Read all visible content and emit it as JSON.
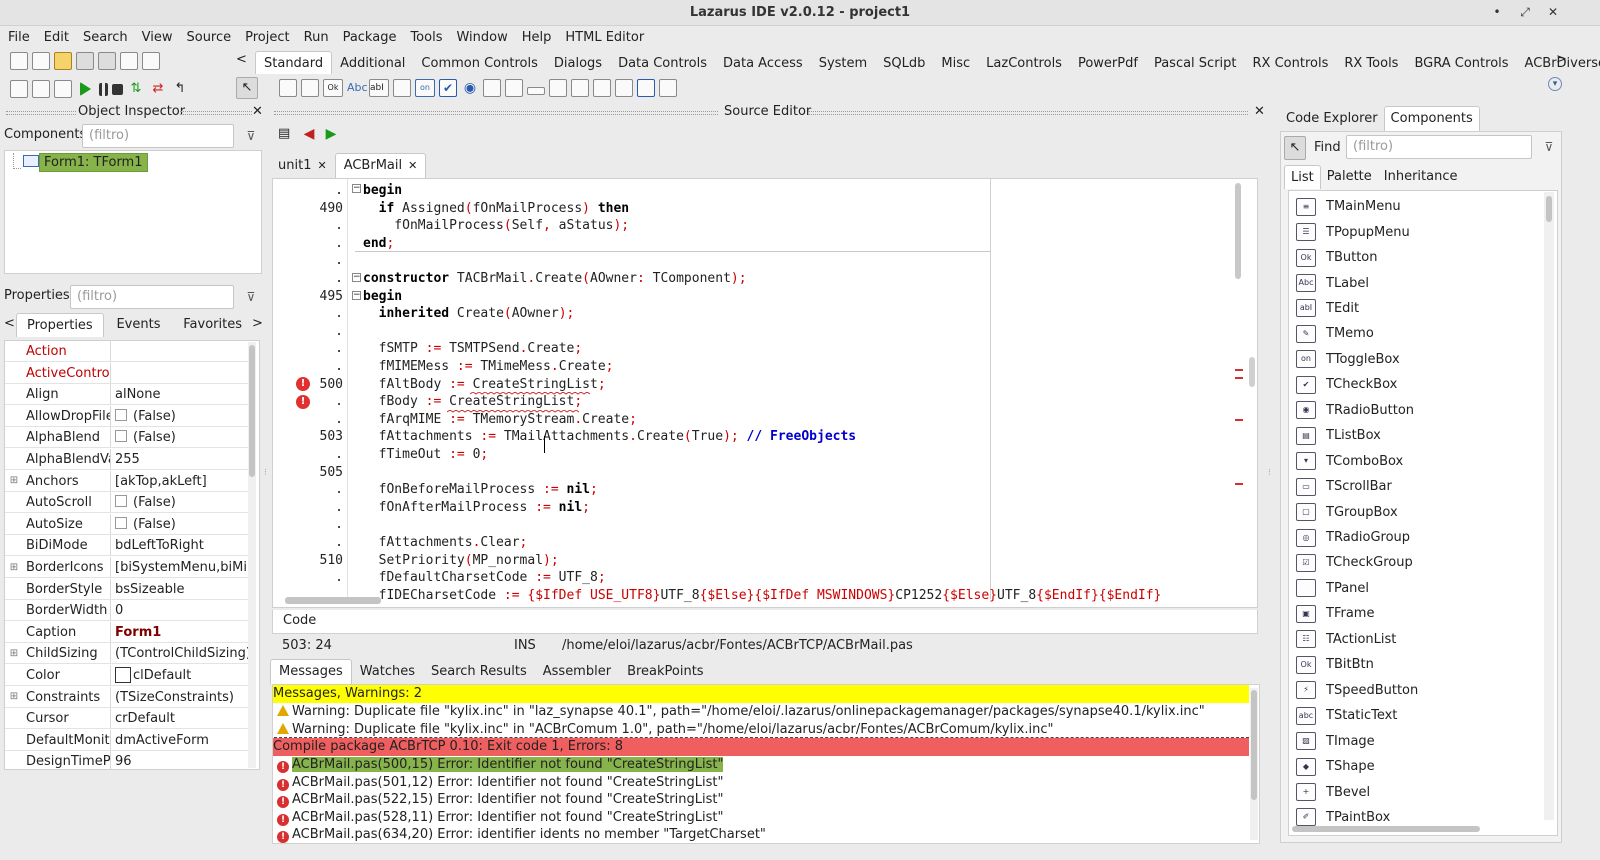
{
  "window": {
    "title": "Lazarus IDE v2.0.12 - project1",
    "minimize": "•",
    "restore": "⤢",
    "close": "✕"
  },
  "menu": [
    "File",
    "Edit",
    "Search",
    "View",
    "Source",
    "Project",
    "Run",
    "Package",
    "Tools",
    "Window",
    "Help",
    "HTML Editor"
  ],
  "palette_tabs": [
    "Standard",
    "Additional",
    "Common Controls",
    "Dialogs",
    "Data Controls",
    "Data Access",
    "System",
    "SQLdb",
    "Misc",
    "LazControls",
    "PowerPdf",
    "Pascal Script",
    "RX Controls",
    "RX Tools",
    "BGRA Controls",
    "ACBrDiversos"
  ],
  "palette_selected": "Standard",
  "palette_scroll_left": "<",
  "palette_scroll_right": ">",
  "object_inspector": {
    "title": "Object Inspector",
    "components_label": "Components",
    "filter_placeholder": "(filtro)",
    "tree_item": "Form1: TForm1",
    "properties_label": "Properties",
    "tabs": [
      "Properties",
      "Events",
      "Favorites"
    ],
    "props": [
      {
        "name": "Action",
        "value": "",
        "red": true
      },
      {
        "name": "ActiveControl",
        "value": "",
        "red": true
      },
      {
        "name": "Align",
        "value": "alNone"
      },
      {
        "name": "AllowDropFiles",
        "value": "(False)",
        "check": true
      },
      {
        "name": "AlphaBlend",
        "value": "(False)",
        "check": true
      },
      {
        "name": "AlphaBlendValue",
        "value": "255"
      },
      {
        "name": "Anchors",
        "value": "[akTop,akLeft]",
        "expand": true
      },
      {
        "name": "AutoScroll",
        "value": "(False)",
        "check": true
      },
      {
        "name": "AutoSize",
        "value": "(False)",
        "check": true
      },
      {
        "name": "BiDiMode",
        "value": "bdLeftToRight"
      },
      {
        "name": "BorderIcons",
        "value": "[biSystemMenu,biMinimize",
        "expand": true
      },
      {
        "name": "BorderStyle",
        "value": "bsSizeable"
      },
      {
        "name": "BorderWidth",
        "value": "0"
      },
      {
        "name": "Caption",
        "value": "Form1",
        "bold": true
      },
      {
        "name": "ChildSizing",
        "value": "(TControlChildSizing)",
        "expand": true
      },
      {
        "name": "Color",
        "value": "clDefault",
        "swatch": true
      },
      {
        "name": "Constraints",
        "value": "(TSizeConstraints)",
        "expand": true
      },
      {
        "name": "Cursor",
        "value": "crDefault"
      },
      {
        "name": "DefaultMonitor",
        "value": "dmActiveForm"
      },
      {
        "name": "DesignTimePPI",
        "value": "96"
      }
    ]
  },
  "source_editor": {
    "title": "Source Editor",
    "tabs": [
      "unit1",
      "ACBrMail"
    ],
    "selected_tab": "ACBrMail",
    "bottom_tab": "Code",
    "status": {
      "pos": "503: 24",
      "mode": "INS",
      "path": "/home/eloi/lazarus/acbr/Fontes/ACBrTCP/ACBrMail.pas"
    },
    "gutter": [
      ".",
      "490",
      ".",
      ".",
      ".",
      ".",
      "495",
      ".",
      ".",
      ".",
      ".",
      "500",
      ".",
      ".",
      "503",
      ".",
      "505",
      ".",
      ".",
      ".",
      ".",
      "510",
      ".",
      "."
    ],
    "lines": [
      [
        [
          "kw",
          "begin"
        ]
      ],
      [
        [
          "t",
          "  "
        ],
        [
          "kw",
          "if"
        ],
        [
          "t",
          " Assigned"
        ],
        [
          "op",
          "("
        ],
        [
          "t",
          "fOnMailProcess"
        ],
        [
          "op",
          ")"
        ],
        [
          "t",
          " "
        ],
        [
          "kw",
          "then"
        ]
      ],
      [
        [
          "t",
          "    fOnMailProcess"
        ],
        [
          "op",
          "("
        ],
        [
          "t",
          "Self"
        ],
        [
          "op",
          ","
        ],
        [
          "t",
          " aStatus"
        ],
        [
          "op",
          ");"
        ]
      ],
      [
        [
          "kw",
          "end"
        ],
        [
          "op",
          ";"
        ]
      ],
      [
        [
          "t",
          ""
        ]
      ],
      [
        [
          "kw",
          "constructor"
        ],
        [
          "t",
          " TACBrMail"
        ],
        [
          "op",
          "."
        ],
        [
          "t",
          "Create"
        ],
        [
          "op",
          "("
        ],
        [
          "t",
          "AOwner"
        ],
        [
          "op",
          ":"
        ],
        [
          "t",
          " TComponent"
        ],
        [
          "op",
          ");"
        ]
      ],
      [
        [
          "kw",
          "begin"
        ]
      ],
      [
        [
          "t",
          "  "
        ],
        [
          "kw",
          "inherited"
        ],
        [
          "t",
          " Create"
        ],
        [
          "op",
          "("
        ],
        [
          "t",
          "AOwner"
        ],
        [
          "op",
          ");"
        ]
      ],
      [
        [
          "t",
          ""
        ]
      ],
      [
        [
          "t",
          "  fSMTP "
        ],
        [
          "op",
          ":="
        ],
        [
          "t",
          " TSMTPSend"
        ],
        [
          "op",
          "."
        ],
        [
          "t",
          "Create"
        ],
        [
          "op",
          ";"
        ]
      ],
      [
        [
          "t",
          "  fMIMEMess "
        ],
        [
          "op",
          ":="
        ],
        [
          "t",
          " TMimeMess"
        ],
        [
          "op",
          "."
        ],
        [
          "t",
          "Create"
        ],
        [
          "op",
          ";"
        ]
      ],
      [
        [
          "t",
          "  fAltBody "
        ],
        [
          "op",
          ":="
        ],
        [
          "t",
          " CreateStringList"
        ],
        [
          "op",
          ";"
        ]
      ],
      [
        [
          "t",
          "  fBody "
        ],
        [
          "op",
          ":="
        ],
        [
          "t",
          " CreateStringList"
        ],
        [
          "op",
          ";"
        ]
      ],
      [
        [
          "t",
          "  fArqMIME "
        ],
        [
          "op",
          ":="
        ],
        [
          "t",
          " TMemoryStream"
        ],
        [
          "op",
          "."
        ],
        [
          "t",
          "Create"
        ],
        [
          "op",
          ";"
        ]
      ],
      [
        [
          "t",
          "  fAttachments "
        ],
        [
          "op",
          ":="
        ],
        [
          "t",
          " TMailAttachments"
        ],
        [
          "op",
          "."
        ],
        [
          "t",
          "Create"
        ],
        [
          "op",
          "("
        ],
        [
          "t",
          "True"
        ],
        [
          "op",
          ");"
        ],
        [
          "t",
          " "
        ],
        [
          "cm",
          "// FreeObjects"
        ]
      ],
      [
        [
          "t",
          "  fTimeOut "
        ],
        [
          "op",
          ":="
        ],
        [
          "t",
          " 0"
        ],
        [
          "op",
          ";"
        ]
      ],
      [
        [
          "t",
          ""
        ]
      ],
      [
        [
          "t",
          "  fOnBeforeMailProcess "
        ],
        [
          "op",
          ":="
        ],
        [
          "t",
          " "
        ],
        [
          "kw",
          "nil"
        ],
        [
          "op",
          ";"
        ]
      ],
      [
        [
          "t",
          "  fOnAfterMailProcess "
        ],
        [
          "op",
          ":="
        ],
        [
          "t",
          " "
        ],
        [
          "kw",
          "nil"
        ],
        [
          "op",
          ";"
        ]
      ],
      [
        [
          "t",
          ""
        ]
      ],
      [
        [
          "t",
          "  fAttachments"
        ],
        [
          "op",
          "."
        ],
        [
          "t",
          "Clear"
        ],
        [
          "op",
          ";"
        ]
      ],
      [
        [
          "t",
          "  SetPriority"
        ],
        [
          "op",
          "("
        ],
        [
          "t",
          "MP_normal"
        ],
        [
          "op",
          ");"
        ]
      ],
      [
        [
          "t",
          "  fDefaultCharsetCode "
        ],
        [
          "op",
          ":="
        ],
        [
          "t",
          " UTF_8"
        ],
        [
          "op",
          ";"
        ]
      ],
      [
        [
          "t",
          "  fIDECharsetCode "
        ],
        [
          "op",
          ":="
        ],
        [
          "t",
          " "
        ],
        [
          "dir",
          "{$IfDef USE_UTF8}"
        ],
        [
          "t",
          "UTF_8"
        ],
        [
          "dir",
          "{$Else}{$IfDef MSWINDOWS}"
        ],
        [
          "t",
          "CP1252"
        ],
        [
          "dir",
          "{$Else}"
        ],
        [
          "t",
          "UTF_8"
        ],
        [
          "dir",
          "{$EndIf}{$EndIf}"
        ]
      ]
    ]
  },
  "messages": {
    "tabs": [
      "Messages",
      "Watches",
      "Search Results",
      "Assembler",
      "BreakPoints"
    ],
    "selected_tab": "Messages",
    "header": "Messages, Warnings: 2",
    "warnings": [
      "Warning: Duplicate file \"kylix.inc\" in \"laz_synapse 40.1\", path=\"/home/eloi/.lazarus/onlinepackagemanager/packages/synapse40.1/kylix.inc\"",
      "Warning: Duplicate file \"kylix.inc\" in \"ACBrComum 1.0\", path=\"/home/eloi/lazarus/acbr/Fontes/ACBrComum/kylix.inc\""
    ],
    "compile_header": "Compile package ACBrTCP 0.10: Exit code 1, Errors: 8",
    "errors": [
      "ACBrMail.pas(500,15) Error: Identifier not found \"CreateStringList\"",
      "ACBrMail.pas(501,12) Error: Identifier not found \"CreateStringList\"",
      "ACBrMail.pas(522,15) Error: Identifier not found \"CreateStringList\"",
      "ACBrMail.pas(528,11) Error: Identifier not found \"CreateStringList\"",
      "ACBrMail.pas(634,20) Error: identifier idents no member \"TargetCharset\""
    ]
  },
  "right_panel": {
    "tabs": [
      "Code Explorer",
      "Components"
    ],
    "selected_tab": "Components",
    "find_label": "Find",
    "filter_placeholder": "(filtro)",
    "subtabs": [
      "List",
      "Palette",
      "Inheritance"
    ],
    "selected_subtab": "List",
    "components": [
      {
        "name": "TMainMenu",
        "icon": "≡"
      },
      {
        "name": "TPopupMenu",
        "icon": "☰"
      },
      {
        "name": "TButton",
        "icon": "Ok"
      },
      {
        "name": "TLabel",
        "icon": "Abc"
      },
      {
        "name": "TEdit",
        "icon": "abI"
      },
      {
        "name": "TMemo",
        "icon": "✎"
      },
      {
        "name": "TToggleBox",
        "icon": "on"
      },
      {
        "name": "TCheckBox",
        "icon": "✔"
      },
      {
        "name": "TRadioButton",
        "icon": "◉"
      },
      {
        "name": "TListBox",
        "icon": "▤"
      },
      {
        "name": "TComboBox",
        "icon": "▾"
      },
      {
        "name": "TScrollBar",
        "icon": "▭"
      },
      {
        "name": "TGroupBox",
        "icon": "▢"
      },
      {
        "name": "TRadioGroup",
        "icon": "◎"
      },
      {
        "name": "TCheckGroup",
        "icon": "☑"
      },
      {
        "name": "TPanel",
        "icon": ""
      },
      {
        "name": "TFrame",
        "icon": "▣"
      },
      {
        "name": "TActionList",
        "icon": "☷"
      },
      {
        "name": "TBitBtn",
        "icon": "Ok"
      },
      {
        "name": "TSpeedButton",
        "icon": "⚡"
      },
      {
        "name": "TStaticText",
        "icon": "abc"
      },
      {
        "name": "TImage",
        "icon": "▨"
      },
      {
        "name": "TShape",
        "icon": "◆"
      },
      {
        "name": "TBevel",
        "icon": "+"
      },
      {
        "name": "TPaintBox",
        "icon": "✐"
      }
    ]
  }
}
